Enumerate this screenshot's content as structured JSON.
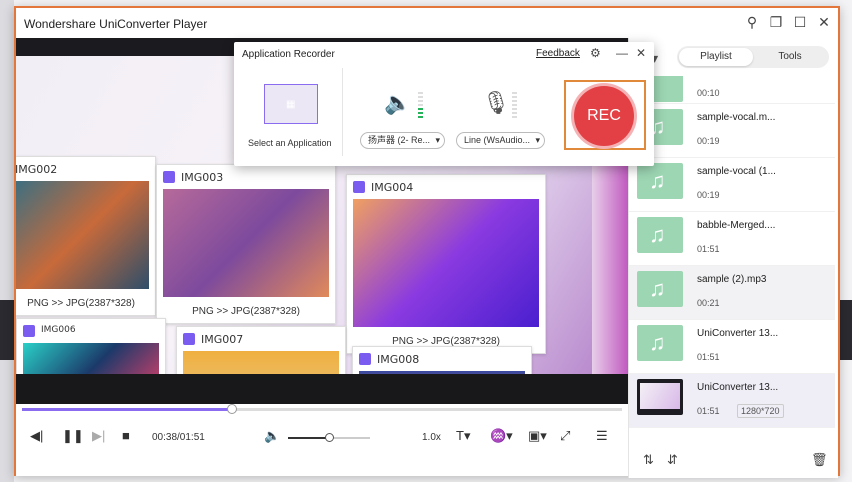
{
  "window": {
    "title": "Wondershare UniConverter Player",
    "controls": {
      "pin": "⚲",
      "restore": "❐",
      "maximize": "☐",
      "close": "✕"
    }
  },
  "video": {
    "thumbnails": [
      {
        "label": "IMG002",
        "caption": "PNG >> JPG(2387*328)"
      },
      {
        "label": "IMG003",
        "caption": "PNG >> JPG(2387*328)"
      },
      {
        "label": "IMG004",
        "caption": "PNG >> JPG(2387*328)"
      },
      {
        "label": "IMG006",
        "caption": ""
      },
      {
        "label": "IMG007",
        "caption": ""
      },
      {
        "label": "IMG008",
        "caption": ""
      }
    ]
  },
  "player": {
    "time": "00:38/01:51",
    "progress_fraction": 0.35,
    "volume_fraction": 0.5,
    "speed": "1.0x"
  },
  "sidebar": {
    "tabs": {
      "playlist": "Playlist",
      "tools": "Tools"
    },
    "items": [
      {
        "name": "",
        "duration": "00:10",
        "resolution": ""
      },
      {
        "name": "sample-vocal.m...",
        "duration": "00:19",
        "resolution": ""
      },
      {
        "name": "sample-vocal (1...",
        "duration": "00:19",
        "resolution": ""
      },
      {
        "name": "babble-Merged....",
        "duration": "01:51",
        "resolution": ""
      },
      {
        "name": "sample (2).mp3",
        "duration": "00:21",
        "resolution": ""
      },
      {
        "name": "UniConverter 13...",
        "duration": "01:51",
        "resolution": ""
      },
      {
        "name": "UniConverter 13...",
        "duration": "01:51",
        "resolution": "1280*720"
      }
    ]
  },
  "recorder": {
    "title": "Application Recorder",
    "feedback": "Feedback",
    "select_app": "Select an Application",
    "speaker_device": "扬声器 (2- Re...",
    "mic_device": "Line (WsAudio...",
    "rec_label": "REC"
  },
  "colors": {
    "accent": "#8a6cf0",
    "window_border": "#e3763a",
    "rec": "#e34045",
    "audio_thumb": "#9dd6b3"
  }
}
